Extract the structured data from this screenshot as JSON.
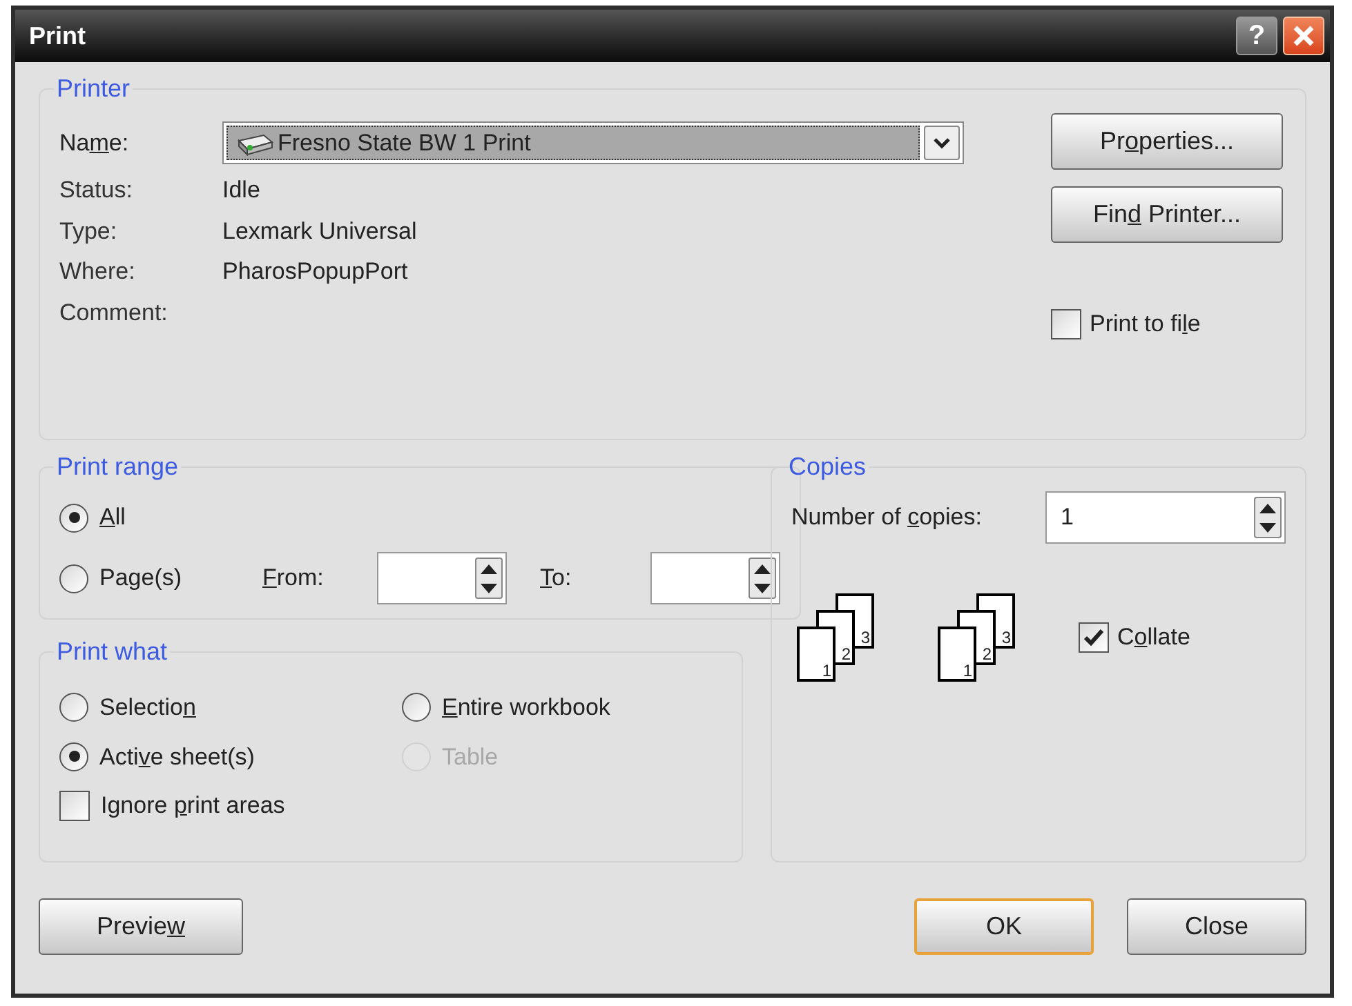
{
  "window": {
    "title": "Print",
    "help_button": "?"
  },
  "printer": {
    "legend": "Printer",
    "name_label": [
      "Na",
      {
        "key": "m"
      },
      "e:"
    ],
    "name_value": "Fresno State BW 1 Print",
    "details": [
      {
        "label": "Status:",
        "value": "Idle"
      },
      {
        "label": "Type:",
        "value": "Lexmark Universal"
      },
      {
        "label": "Where:",
        "value": "PharosPopupPort"
      },
      {
        "label": "Comment:"
      }
    ],
    "properties_button": [
      "Pr",
      {
        "key": "o"
      },
      "perties..."
    ],
    "find_button": [
      "Fin",
      {
        "key": "d"
      },
      " Printer..."
    ],
    "print_to_file": {
      "label": [
        "Print to fi",
        {
          "key": "l"
        },
        "e"
      ],
      "checked": false
    }
  },
  "print_range": {
    "legend": "Print range",
    "options": [
      {
        "label": [
          {
            "key": "A"
          },
          "ll"
        ],
        "selected": true
      },
      {
        "label": [
          "Pa",
          {
            "key": "g"
          },
          "e(s)"
        ],
        "selected": false
      }
    ],
    "from_label": [
      {
        "key": "F"
      },
      "rom:"
    ],
    "to_label": [
      {
        "key": "T"
      },
      "o:"
    ]
  },
  "print_what": {
    "legend": "Print what",
    "options": [
      {
        "label": [
          "Selectio",
          {
            "key": "n"
          }
        ],
        "selected": false,
        "disabled": false
      },
      {
        "label": [
          {
            "key": "E"
          },
          "ntire workbook"
        ],
        "selected": false,
        "disabled": false
      },
      {
        "label": [
          "Acti",
          {
            "key": "v"
          },
          "e sheet(s)"
        ],
        "selected": true,
        "disabled": false
      },
      {
        "label": [
          "Table"
        ],
        "selected": false,
        "disabled": true
      }
    ],
    "ignore_print_areas": {
      "label": [
        "Ignore ",
        {
          "key": "p"
        },
        "rint areas"
      ],
      "checked": false
    }
  },
  "copies": {
    "legend": "Copies",
    "number_label": [
      "Number of ",
      {
        "key": "c"
      },
      "opies:"
    ],
    "number_value": "1",
    "stacks": [
      {
        "pages": [
          "1",
          "2",
          "3"
        ]
      },
      {
        "pages": [
          "1",
          "2",
          "3"
        ]
      }
    ],
    "collate": {
      "label": [
        "C",
        {
          "key": "o"
        },
        "llate"
      ],
      "checked": true
    }
  },
  "buttons": [
    {
      "label": [
        "Previe",
        {
          "key": "w"
        }
      ],
      "default": false
    },
    {
      "label": [
        "OK"
      ],
      "default": true
    },
    {
      "label": [
        "Close"
      ],
      "default": false
    }
  ]
}
